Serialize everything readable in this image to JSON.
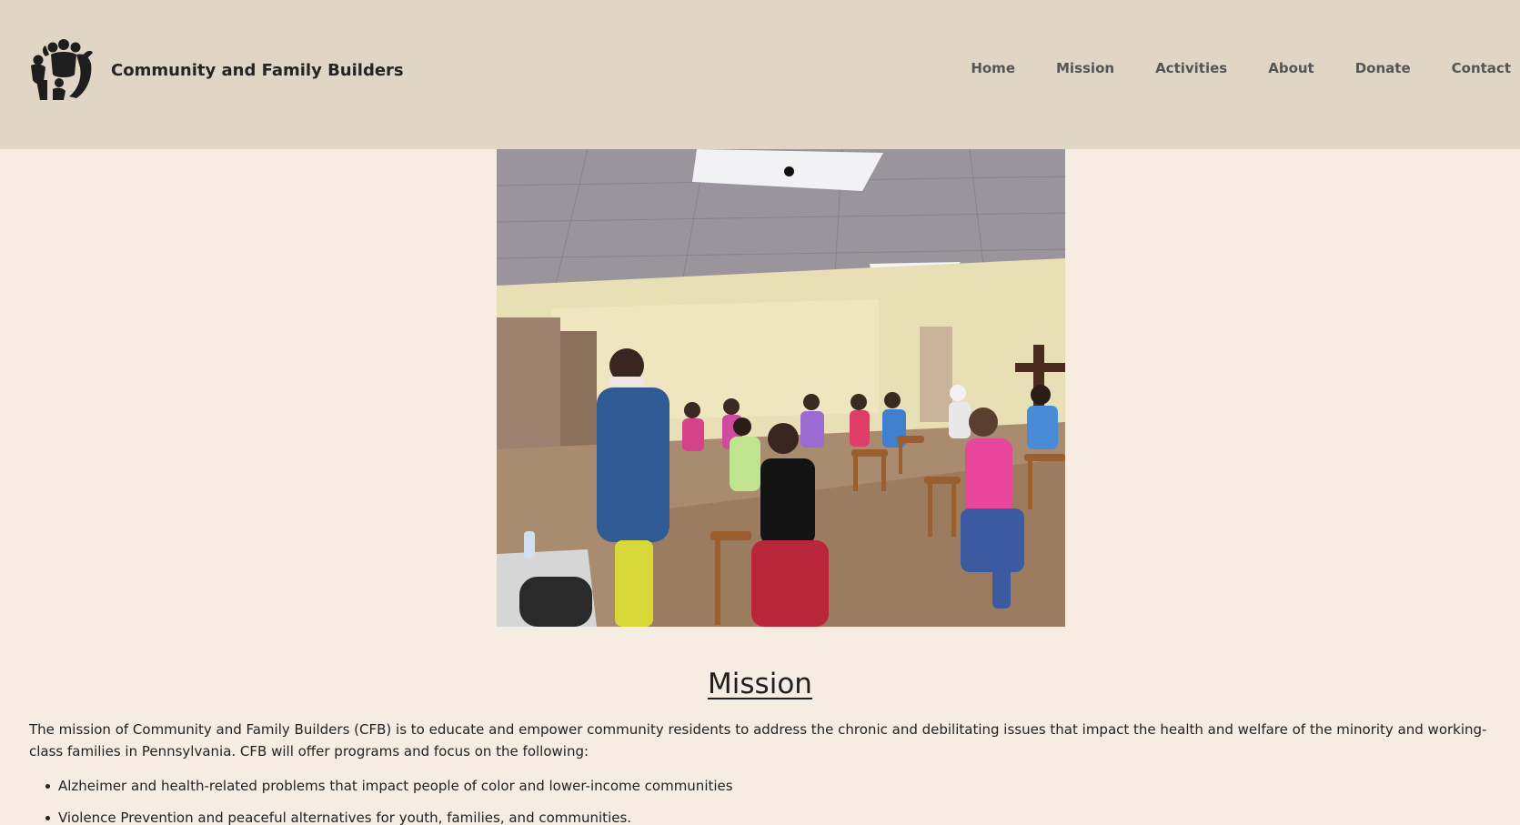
{
  "site": {
    "name": "Community and Family Builders",
    "logo_icon": "family-group-icon"
  },
  "nav": {
    "items": [
      {
        "label": "Home"
      },
      {
        "label": "Mission"
      },
      {
        "label": "Activities"
      },
      {
        "label": "About"
      },
      {
        "label": "Donate"
      },
      {
        "label": "Contact"
      }
    ]
  },
  "hero": {
    "carousel_slide_count": 1,
    "active_slide": 1
  },
  "mission": {
    "heading": "Mission",
    "body": "The mission of Community and Family Builders (CFB) is to educate and empower community residents to address the chronic and debilitating issues that impact the health and welfare of the minority and working-class families in Pennsylvania. CFB will offer programs and focus on the following:",
    "items": [
      "Alzheimer and health-related problems that impact people of color and lower-income communities",
      "Violence Prevention and peaceful alternatives for youth, families, and communities."
    ]
  },
  "colors": {
    "header_bg": "#e1d5c5",
    "page_bg": "#f6ece2",
    "text": "#222222",
    "nav_text": "#555555"
  }
}
